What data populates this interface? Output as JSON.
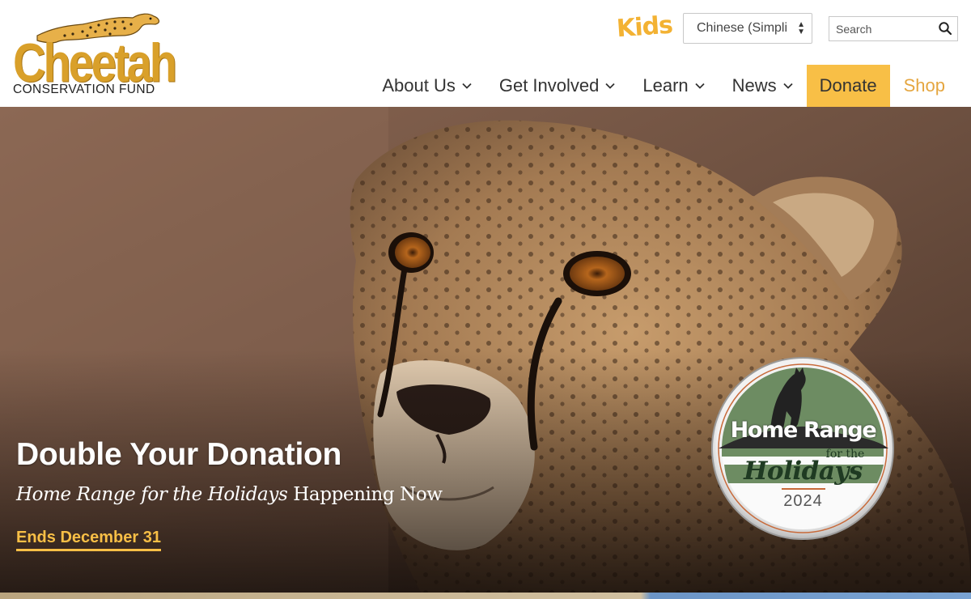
{
  "brand": {
    "logo_word": "Cheetah",
    "logo_sub": "CONSERVATION FUND",
    "gold": "#d9a02a",
    "accent": "#f8bf46"
  },
  "utility": {
    "kids_label": "Kids",
    "language_value": "Chinese (Simpli",
    "search_placeholder": "Search",
    "search_icon": "magnifier-icon"
  },
  "nav": {
    "items": [
      {
        "label": "About Us",
        "icon": "chevron-down-icon"
      },
      {
        "label": "Get Involved",
        "icon": "chevron-down-icon"
      },
      {
        "label": "Learn",
        "icon": "chevron-down-icon"
      },
      {
        "label": "News",
        "icon": "chevron-down-icon"
      }
    ],
    "donate_label": "Donate",
    "shop_label": "Shop"
  },
  "hero": {
    "title": "Double Your Donation",
    "subtitle_italic": "Home Range for the Holidays",
    "subtitle_rest": " Happening Now",
    "cta": "Ends December 31",
    "badge": {
      "line1": "Home Range",
      "line2": "for the",
      "line3": "Holidays",
      "year": "2024"
    }
  }
}
